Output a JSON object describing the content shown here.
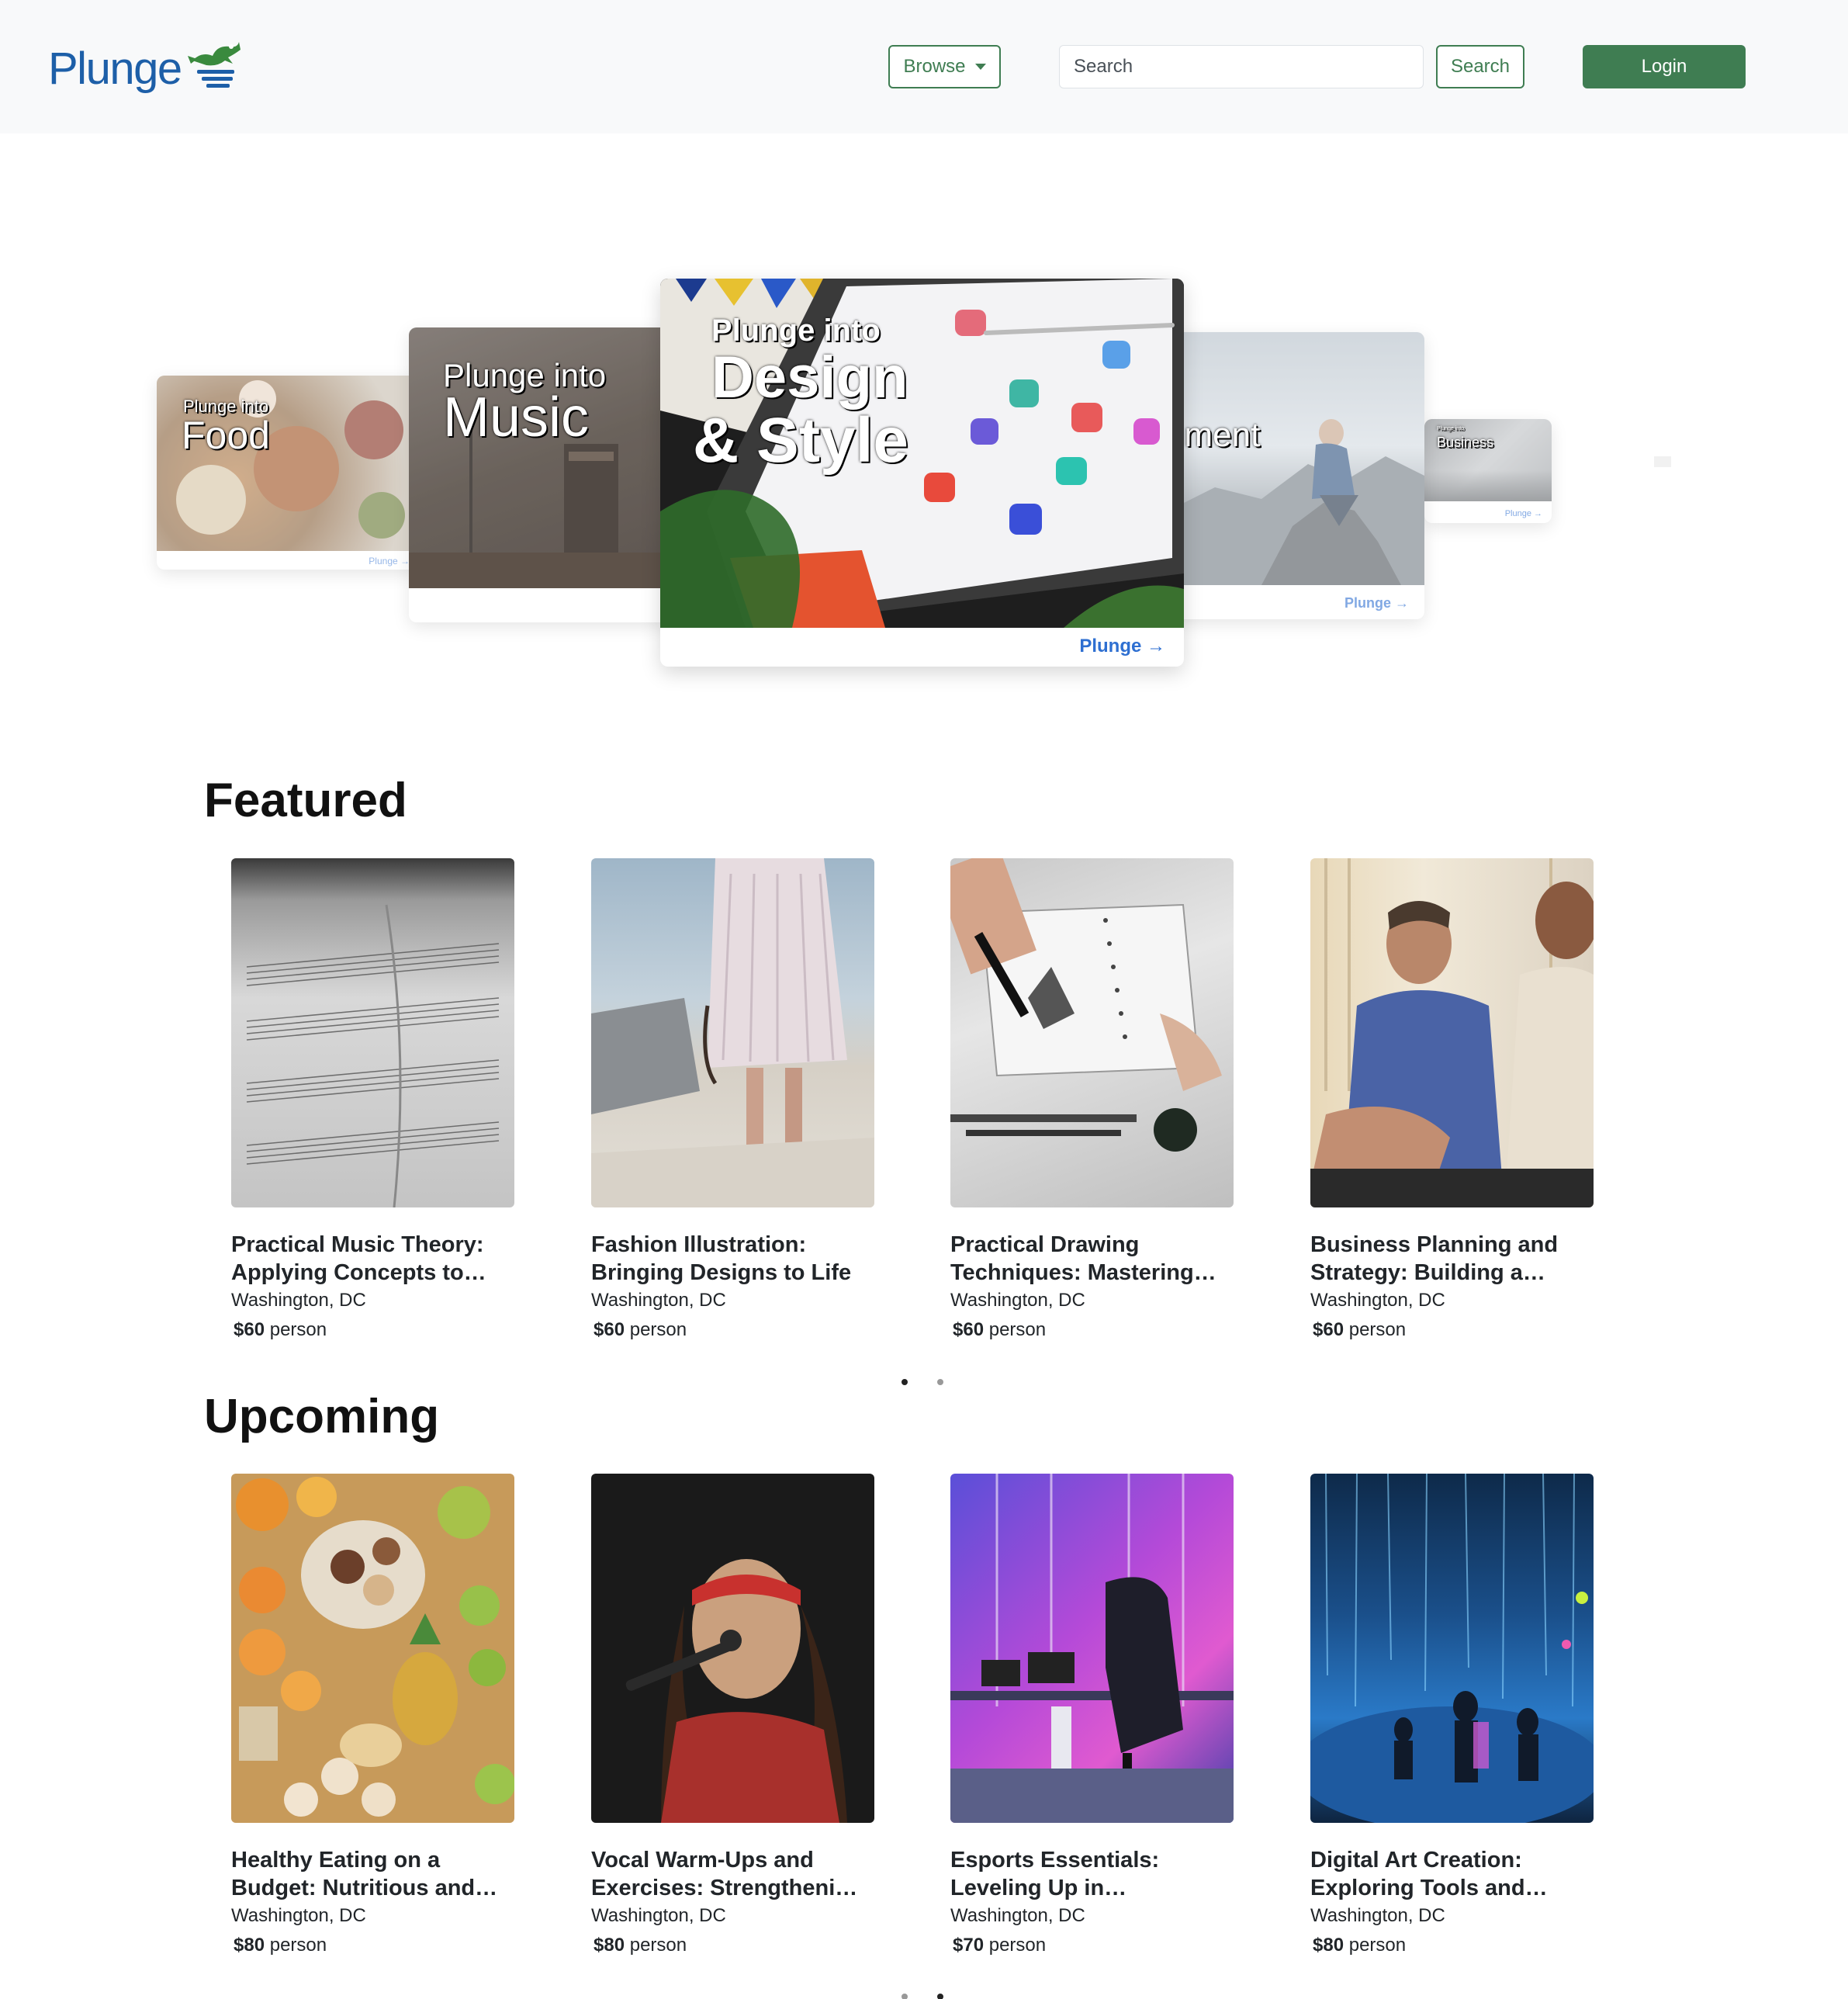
{
  "brand": {
    "name": "Plunge"
  },
  "nav": {
    "browse_label": "Browse",
    "search_placeholder": "Search",
    "search_button": "Search",
    "login_button": "Login"
  },
  "hero": {
    "slides": [
      {
        "prefix": "Plunge into",
        "topic": "Food",
        "cta": "Plunge →"
      },
      {
        "prefix": "Plunge into",
        "topic": "Music",
        "cta": ""
      },
      {
        "prefix": "Plunge into",
        "topic": "Design",
        "topic2": "& Style",
        "cta": "Plunge →"
      },
      {
        "prefix": "",
        "topic": "nment",
        "cta": "Plunge →"
      },
      {
        "prefix": "Plunge into",
        "topic": "Business",
        "cta": "Plunge →"
      }
    ]
  },
  "featured": {
    "title": "Featured",
    "items": [
      {
        "title": "Practical Music Theory: Applying Concepts to…",
        "location": "Washington, DC",
        "price": "$60",
        "unit": "person",
        "image": "sheet-music"
      },
      {
        "title": "Fashion Illustration: Bringing Designs to Life",
        "location": "Washington, DC",
        "price": "$60",
        "unit": "person",
        "image": "beach-dress"
      },
      {
        "title": "Practical Drawing Techniques: Mastering…",
        "location": "Washington, DC",
        "price": "$60",
        "unit": "person",
        "image": "sketchbook"
      },
      {
        "title": "Business Planning and Strategy: Building a…",
        "location": "Washington, DC",
        "price": "$60",
        "unit": "person",
        "image": "business-men"
      }
    ]
  },
  "upcoming": {
    "title": "Upcoming",
    "items": [
      {
        "title": "Healthy Eating on a Budget: Nutritious and…",
        "location": "Washington, DC",
        "price": "$80",
        "unit": "person",
        "image": "food-spread"
      },
      {
        "title": "Vocal Warm-Ups and Exercises: Strengtheni…",
        "location": "Washington, DC",
        "price": "$80",
        "unit": "person",
        "image": "singer"
      },
      {
        "title": "Esports Essentials: Leveling Up in…",
        "location": "Washington, DC",
        "price": "$70",
        "unit": "person",
        "image": "gaming-room"
      },
      {
        "title": "Digital Art Creation: Exploring Tools and…",
        "location": "Washington, DC",
        "price": "$80",
        "unit": "person",
        "image": "digital-art"
      }
    ]
  },
  "colors": {
    "brand_blue": "#1d5fa8",
    "accent_green": "#3f7d52",
    "link_blue": "#2e6fd1",
    "navbar_bg": "#f8f9fa"
  }
}
